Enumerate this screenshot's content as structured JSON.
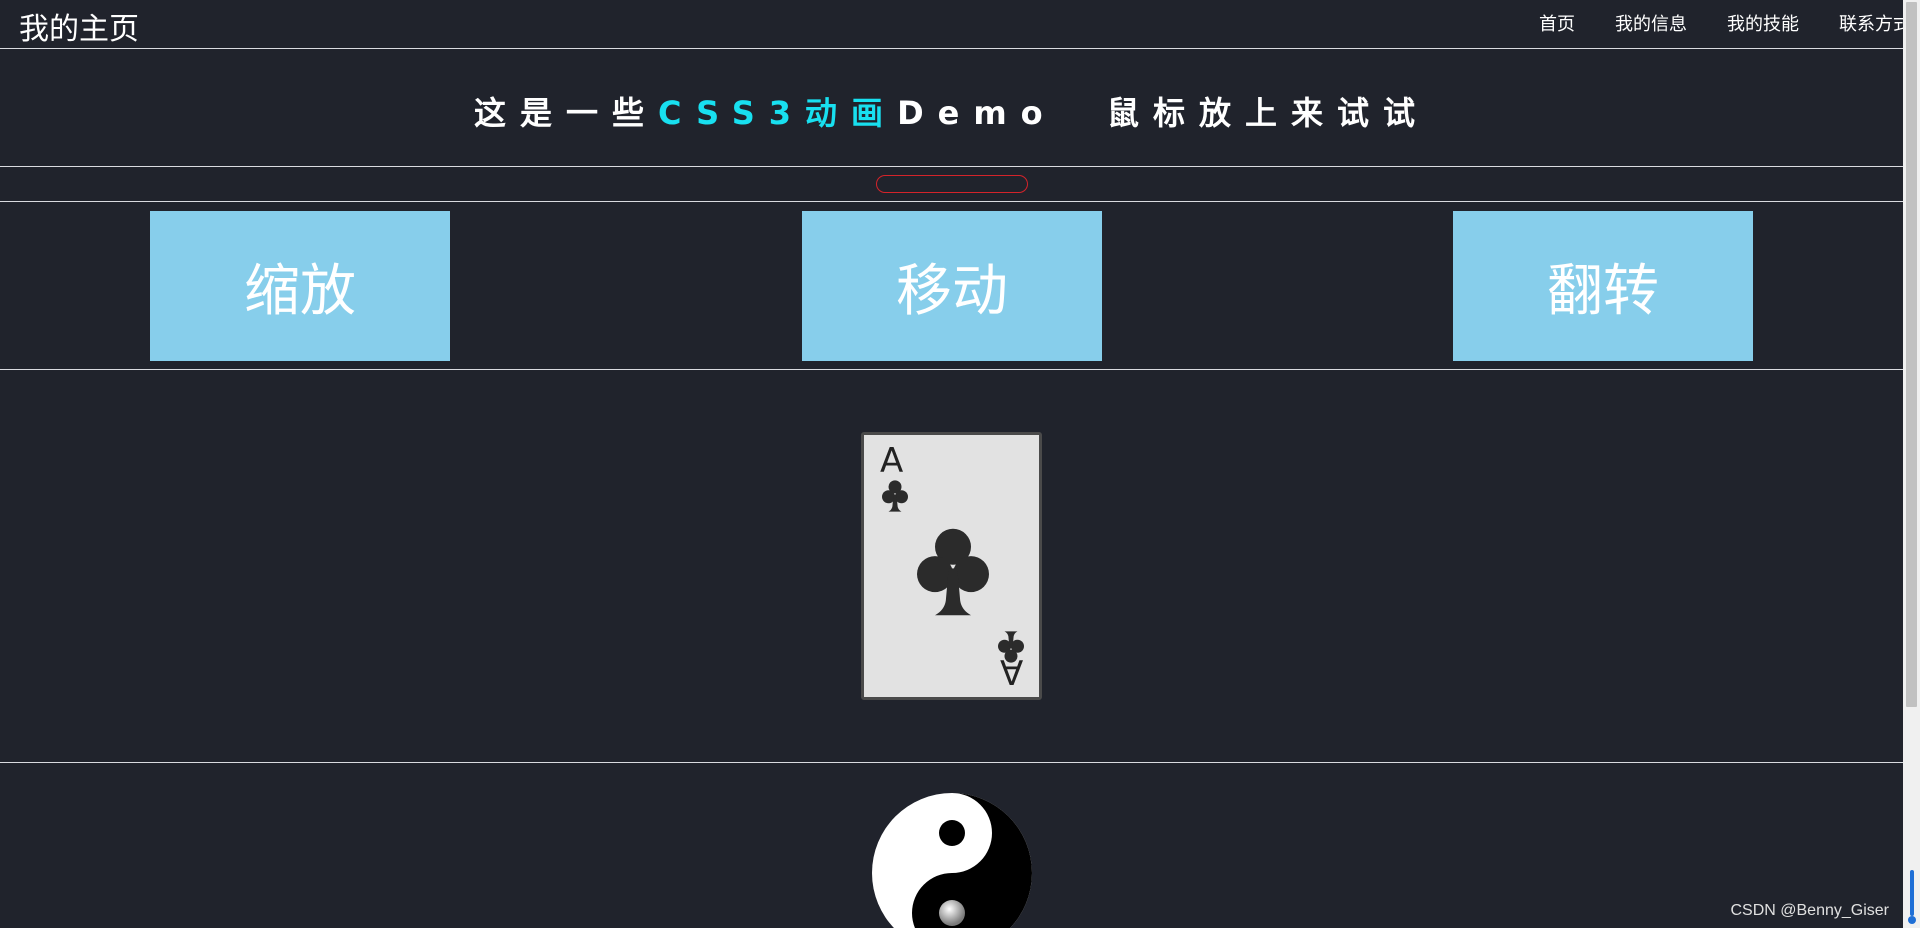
{
  "navbar": {
    "brand": "我的主页",
    "links": [
      "首页",
      "我的信息",
      "我的技能",
      "联系方式"
    ]
  },
  "hero": {
    "prefix": "这是一些",
    "highlight": "CSS3动画",
    "suffix": "Demo  鼠标放上来试试"
  },
  "boxes": [
    "缩放",
    "移动",
    "翻转"
  ],
  "card": {
    "rank": "A",
    "suit": "club-icon"
  },
  "watermark": "CSDN @Benny_Giser",
  "colors": {
    "background": "#20232c",
    "box": "#87ceeb",
    "highlight": "#18e0f0",
    "red_outline": "#d4232a"
  }
}
